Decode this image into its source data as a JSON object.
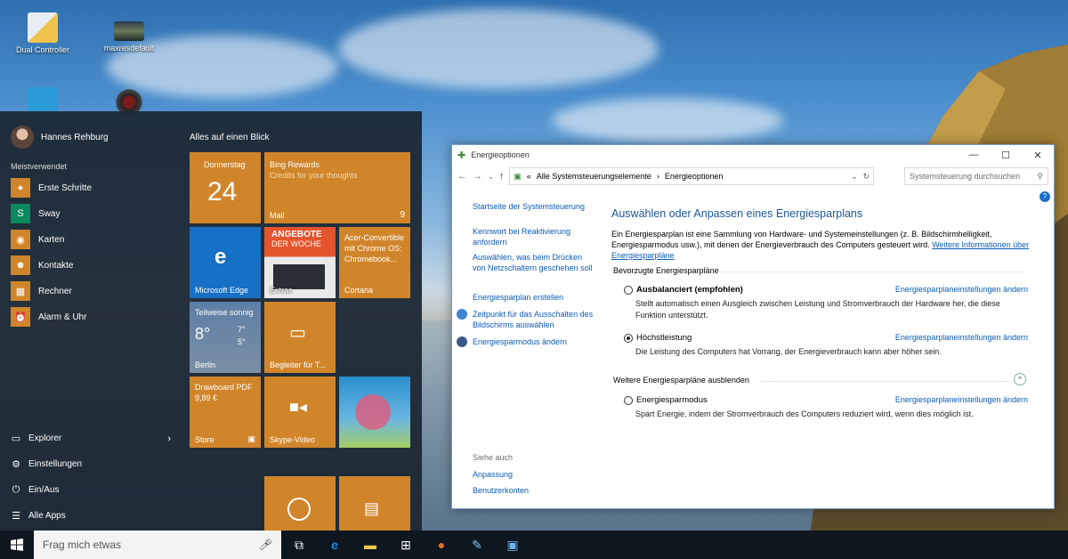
{
  "desktop": {
    "icons": [
      {
        "label": "Dual Controller",
        "icon": "dual-controller-icon"
      },
      {
        "label": "maxresdefault",
        "icon": "image-file-icon"
      },
      {
        "label": "",
        "icon": "app-shortcut-icon"
      },
      {
        "label": "",
        "icon": "spider-app-icon"
      }
    ]
  },
  "start_menu": {
    "user_name": "Hannes Rehburg",
    "most_used_title": "Meistverwendet",
    "apps": [
      {
        "label": "Erste Schritte",
        "icon": "lightbulb-icon"
      },
      {
        "label": "Sway",
        "icon": "sway-icon"
      },
      {
        "label": "Karten",
        "icon": "maps-icon"
      },
      {
        "label": "Kontakte",
        "icon": "people-icon"
      },
      {
        "label": "Rechner",
        "icon": "calculator-icon"
      },
      {
        "label": "Alarm & Uhr",
        "icon": "alarm-clock-icon"
      }
    ],
    "bottom": [
      {
        "label": "Explorer",
        "icon": "folder-icon"
      },
      {
        "label": "Einstellungen",
        "icon": "gear-icon"
      },
      {
        "label": "Ein/Aus",
        "icon": "power-icon"
      },
      {
        "label": "Alle Apps",
        "icon": "list-icon"
      }
    ],
    "tiles_title": "Alles auf einen Blick",
    "tiles": {
      "calendar": {
        "day_name": "Donnerstag",
        "day_num": "24"
      },
      "mail": {
        "title": "Bing Rewards",
        "subtitle": "Credits for your thoughts",
        "label": "Mail",
        "count": "9"
      },
      "edge": {
        "label": "Microsoft Edge"
      },
      "angebote": {
        "line1": "ANGEBOTE",
        "line2": "DER WOCHE",
        "label": "Extras"
      },
      "cortana": {
        "text": "Acer-Convertible mit Chrome OS: Chromebook...",
        "label": "Cortana"
      },
      "weather": {
        "title": "Teilweise sonnig",
        "temp": "8°",
        "hi": "7°",
        "lo": "5°",
        "city": "Berlin"
      },
      "begleiter": {
        "label": "Begleiter für T..."
      },
      "store": {
        "title": "Drawboard PDF",
        "price": "9,89 €",
        "label": "Store"
      },
      "skype": {
        "label": "Skype-Video"
      }
    }
  },
  "taskbar": {
    "search_placeholder": "Frag mich etwas",
    "icons": [
      "task-view-icon",
      "edge-icon",
      "explorer-icon",
      "store-icon",
      "maps-pin-icon",
      "paint-icon",
      "control-panel-icon"
    ]
  },
  "window": {
    "title": "Energieoptionen",
    "breadcrumb": [
      "«",
      "Alle Systemsteuerungselemente",
      "›",
      "Energieoptionen"
    ],
    "search_placeholder": "Systemsteuerung durchsuchen",
    "left_nav": [
      "Startseite der Systemsteuerung",
      "Kennwort bei Reaktivierung anfordern",
      "Auswählen, was beim Drücken von Netzschaltern geschehen soll",
      "Energiesparplan erstellen",
      "Zeitpunkt für das Ausschalten des Bildschirms auswählen",
      "Energiesparmodus ändern"
    ],
    "see_also_title": "Siehe auch",
    "see_also": [
      "Anpassung",
      "Benutzerkonten"
    ],
    "heading": "Auswählen oder Anpassen eines Energiesparplans",
    "intro": "Ein Energiesparplan ist eine Sammlung von Hardware- und Systemeinstellungen (z. B. Bildschirmhelligkeit, Energiesparmodus usw.), mit denen der Energieverbrauch des Computers gesteuert wird.",
    "intro_link": "Weitere Informationen über Energiesparpläne",
    "preferred_title": "Bevorzugte Energiesparpläne",
    "more_title": "Weitere Energiesparpläne ausblenden",
    "change_link": "Energiesparplaneinstellungen ändern",
    "plans": [
      {
        "name": "Ausbalanciert (empfohlen)",
        "selected": false,
        "desc": "Stellt automatisch einen Ausgleich zwischen Leistung und Stromverbrauch der Hardware her, die diese Funktion unterstützt."
      },
      {
        "name": "Höchstleistung",
        "selected": true,
        "desc": "Die Leistung des Computers hat Vorrang, der Energieverbrauch kann aber höher sein."
      },
      {
        "name": "Energiesparmodus",
        "selected": false,
        "desc": "Spart Energie, indem der Stromverbrauch des Computers reduziert wird, wenn dies möglich ist."
      }
    ]
  }
}
